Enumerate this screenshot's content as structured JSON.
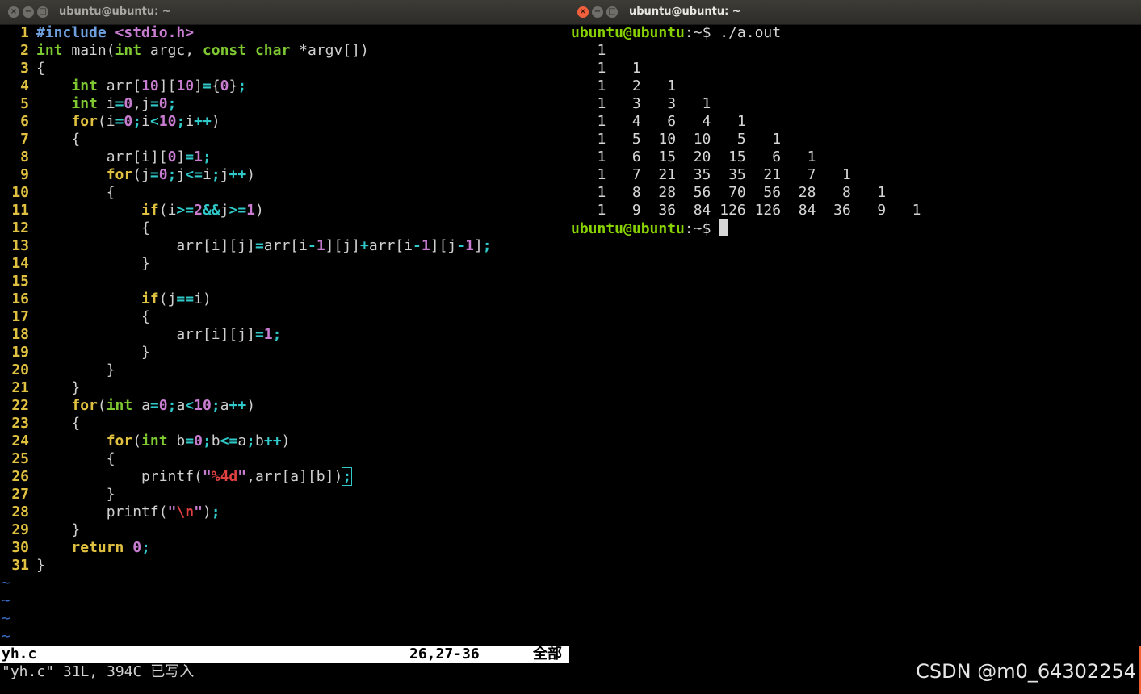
{
  "left_window": {
    "title": "ubuntu@ubuntu: ~",
    "buttons": [
      {
        "icon": "close-icon",
        "glyph": "×"
      },
      {
        "icon": "minimize-icon",
        "glyph": "−"
      },
      {
        "icon": "maximize-icon",
        "glyph": "□"
      }
    ]
  },
  "right_window": {
    "title": "ubuntu@ubuntu: ~",
    "buttons": [
      {
        "icon": "close-icon",
        "glyph": "×"
      },
      {
        "icon": "minimize-icon",
        "glyph": "−"
      },
      {
        "icon": "maximize-icon",
        "glyph": "□"
      }
    ]
  },
  "colors": {
    "keyword": "#e0c040",
    "type": "#7ec832",
    "number": "#c77cd0",
    "operator": "#30c8c8",
    "string": "#e04040",
    "preproc": "#6ea0e0",
    "linenr": "#e0c040",
    "prompt": "#87d200",
    "tilde": "#3a6ec8"
  },
  "editor": {
    "lines": [
      [
        [
          "pp",
          "#include "
        ],
        [
          "num",
          "<stdio.h>"
        ]
      ],
      [
        [
          "type",
          "int"
        ],
        [
          "t",
          " main("
        ],
        [
          "type",
          "int"
        ],
        [
          "t",
          " argc, "
        ],
        [
          "type",
          "const"
        ],
        [
          "t",
          " "
        ],
        [
          "type",
          "char"
        ],
        [
          "t",
          " *argv[])"
        ]
      ],
      [
        [
          "t",
          "{"
        ]
      ],
      [
        [
          "t",
          "    "
        ],
        [
          "type",
          "int"
        ],
        [
          "t",
          " arr["
        ],
        [
          "num",
          "10"
        ],
        [
          "t",
          "]["
        ],
        [
          "num",
          "10"
        ],
        [
          "t",
          "]"
        ],
        [
          "op",
          "="
        ],
        [
          "t",
          "{"
        ],
        [
          "num",
          "0"
        ],
        [
          "t",
          "}"
        ],
        [
          "op",
          ";"
        ]
      ],
      [
        [
          "t",
          "    "
        ],
        [
          "type",
          "int"
        ],
        [
          "t",
          " i"
        ],
        [
          "op",
          "="
        ],
        [
          "num",
          "0"
        ],
        [
          "t",
          ",j"
        ],
        [
          "op",
          "="
        ],
        [
          "num",
          "0"
        ],
        [
          "op",
          ";"
        ]
      ],
      [
        [
          "t",
          "    "
        ],
        [
          "kw",
          "for"
        ],
        [
          "t",
          "(i"
        ],
        [
          "op",
          "="
        ],
        [
          "num",
          "0"
        ],
        [
          "op",
          ";"
        ],
        [
          "t",
          "i"
        ],
        [
          "op",
          "<"
        ],
        [
          "num",
          "10"
        ],
        [
          "op",
          ";"
        ],
        [
          "t",
          "i"
        ],
        [
          "op",
          "++"
        ],
        [
          "t",
          ")"
        ]
      ],
      [
        [
          "t",
          "    {"
        ]
      ],
      [
        [
          "t",
          "        arr[i]["
        ],
        [
          "num",
          "0"
        ],
        [
          "t",
          "]"
        ],
        [
          "op",
          "="
        ],
        [
          "num",
          "1"
        ],
        [
          "op",
          ";"
        ]
      ],
      [
        [
          "t",
          "        "
        ],
        [
          "kw",
          "for"
        ],
        [
          "t",
          "(j"
        ],
        [
          "op",
          "="
        ],
        [
          "num",
          "0"
        ],
        [
          "op",
          ";"
        ],
        [
          "t",
          "j"
        ],
        [
          "op",
          "<="
        ],
        [
          "t",
          "i"
        ],
        [
          "op",
          ";"
        ],
        [
          "t",
          "j"
        ],
        [
          "op",
          "++"
        ],
        [
          "t",
          ")"
        ]
      ],
      [
        [
          "t",
          "        {"
        ]
      ],
      [
        [
          "t",
          "            "
        ],
        [
          "kw",
          "if"
        ],
        [
          "t",
          "(i"
        ],
        [
          "op",
          ">="
        ],
        [
          "num",
          "2"
        ],
        [
          "op",
          "&&"
        ],
        [
          "t",
          "j"
        ],
        [
          "op",
          ">="
        ],
        [
          "num",
          "1"
        ],
        [
          "t",
          ")"
        ]
      ],
      [
        [
          "t",
          "            {"
        ]
      ],
      [
        [
          "t",
          "                arr[i][j]"
        ],
        [
          "op",
          "="
        ],
        [
          "t",
          "arr[i"
        ],
        [
          "op",
          "-"
        ],
        [
          "num",
          "1"
        ],
        [
          "t",
          "][j]"
        ],
        [
          "op",
          "+"
        ],
        [
          "t",
          "arr[i"
        ],
        [
          "op",
          "-"
        ],
        [
          "num",
          "1"
        ],
        [
          "t",
          "][j"
        ],
        [
          "op",
          "-"
        ],
        [
          "num",
          "1"
        ],
        [
          "t",
          "]"
        ],
        [
          "op",
          ";"
        ]
      ],
      [
        [
          "t",
          "            }"
        ]
      ],
      [],
      [
        [
          "t",
          "            "
        ],
        [
          "kw",
          "if"
        ],
        [
          "t",
          "(j"
        ],
        [
          "op",
          "=="
        ],
        [
          "t",
          "i)"
        ]
      ],
      [
        [
          "t",
          "            {"
        ]
      ],
      [
        [
          "t",
          "                arr[i][j]"
        ],
        [
          "op",
          "="
        ],
        [
          "num",
          "1"
        ],
        [
          "op",
          ";"
        ]
      ],
      [
        [
          "t",
          "            }"
        ]
      ],
      [
        [
          "t",
          "        }"
        ]
      ],
      [
        [
          "t",
          "    }"
        ]
      ],
      [
        [
          "t",
          "    "
        ],
        [
          "kw",
          "for"
        ],
        [
          "t",
          "("
        ],
        [
          "type",
          "int"
        ],
        [
          "t",
          " a"
        ],
        [
          "op",
          "="
        ],
        [
          "num",
          "0"
        ],
        [
          "op",
          ";"
        ],
        [
          "t",
          "a"
        ],
        [
          "op",
          "<"
        ],
        [
          "num",
          "10"
        ],
        [
          "op",
          ";"
        ],
        [
          "t",
          "a"
        ],
        [
          "op",
          "++"
        ],
        [
          "t",
          ")"
        ]
      ],
      [
        [
          "t",
          "    {"
        ]
      ],
      [
        [
          "t",
          "        "
        ],
        [
          "kw",
          "for"
        ],
        [
          "t",
          "("
        ],
        [
          "type",
          "int"
        ],
        [
          "t",
          " b"
        ],
        [
          "op",
          "="
        ],
        [
          "num",
          "0"
        ],
        [
          "op",
          ";"
        ],
        [
          "t",
          "b"
        ],
        [
          "op",
          "<="
        ],
        [
          "t",
          "a"
        ],
        [
          "op",
          ";"
        ],
        [
          "t",
          "b"
        ],
        [
          "op",
          "++"
        ],
        [
          "t",
          ")"
        ]
      ],
      [
        [
          "t",
          "        {"
        ]
      ],
      [
        [
          "t",
          "            printf("
        ],
        [
          "num",
          "\""
        ],
        [
          "str",
          "%4d"
        ],
        [
          "num",
          "\""
        ],
        [
          "t",
          ",arr[a][b])"
        ],
        [
          "cur",
          ";"
        ]
      ],
      [
        [
          "t",
          "        }"
        ]
      ],
      [
        [
          "t",
          "        printf("
        ],
        [
          "num",
          "\""
        ],
        [
          "str",
          "\\n"
        ],
        [
          "num",
          "\""
        ],
        [
          "t",
          ")"
        ],
        [
          "op",
          ";"
        ]
      ],
      [
        [
          "t",
          "    }"
        ]
      ],
      [
        [
          "t",
          "    "
        ],
        [
          "kw",
          "return"
        ],
        [
          "t",
          " "
        ],
        [
          "num",
          "0"
        ],
        [
          "op",
          ";"
        ]
      ],
      [
        [
          "t",
          "}"
        ]
      ]
    ],
    "tilde_count": 4,
    "tilde_char": "~",
    "status_filename": "yh.c",
    "status_position": "26,27-36",
    "status_scroll": "全部",
    "message": "\"yh.c\" 31L, 394C 已写入"
  },
  "terminal": {
    "prompt": "ubuntu@ubuntu",
    "path_suffix": ":~$ ",
    "command": "./a.out",
    "output_lines": [
      "   1",
      "   1   1",
      "   1   2   1",
      "   1   3   3   1",
      "   1   4   6   4   1",
      "   1   5  10  10   5   1",
      "   1   6  15  20  15   6   1",
      "   1   7  21  35  35  21   7   1",
      "   1   8  28  56  70  56  28   8   1",
      "   1   9  36  84 126 126  84  36   9   1"
    ]
  },
  "watermark": "CSDN @m0_64302254"
}
